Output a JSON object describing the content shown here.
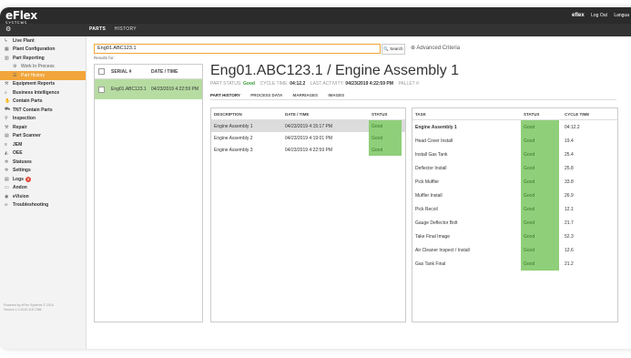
{
  "app": {
    "logo_main": "eFlex",
    "logo_sub": "SYSTEMS",
    "user": "eflex",
    "logout": "Log Out",
    "language": "Langua"
  },
  "top_tabs": {
    "parts": "PARTS",
    "history": "HISTORY"
  },
  "sidebar": {
    "items": [
      {
        "label": "Live Plant",
        "icon": "lightning-icon",
        "type": "item"
      },
      {
        "label": "Plant Configuration",
        "icon": "grid-icon",
        "type": "item"
      },
      {
        "label": "Part Reporting",
        "icon": "bar-chart-icon",
        "type": "item"
      },
      {
        "label": "Work In Process",
        "icon": "gears-icon",
        "type": "sub"
      },
      {
        "label": "Part History",
        "icon": "list-icon",
        "type": "sub-active"
      },
      {
        "label": "Equipment Reports",
        "icon": "wrench-icon",
        "type": "item"
      },
      {
        "label": "Business Intelligence",
        "icon": "search-icon",
        "type": "item"
      },
      {
        "label": "Contain Parts",
        "icon": "hand-icon",
        "type": "item"
      },
      {
        "label": "TNT Contain Parts",
        "icon": "truck-icon",
        "type": "item"
      },
      {
        "label": "Inspection",
        "icon": "magnifier-icon",
        "type": "item"
      },
      {
        "label": "Repair",
        "icon": "hammer-icon",
        "type": "item"
      },
      {
        "label": "Part Scanner",
        "icon": "scanner-icon",
        "type": "item"
      },
      {
        "label": "JEM",
        "icon": "bars-icon",
        "type": "item"
      },
      {
        "label": "OEE",
        "icon": "chart-icon",
        "type": "item"
      },
      {
        "label": "Statuses",
        "icon": "gear-icon",
        "type": "item"
      },
      {
        "label": "Settings",
        "icon": "cog-icon",
        "type": "item"
      },
      {
        "label": "Logs",
        "icon": "document-icon",
        "type": "item",
        "badge": "5"
      },
      {
        "label": "Andon",
        "icon": "monitor-icon",
        "type": "item"
      },
      {
        "label": "eVision",
        "icon": "eye-icon",
        "type": "item"
      },
      {
        "label": "Troubleshooting",
        "icon": "infinity-icon",
        "type": "item"
      }
    ],
    "footer_line1": "Powered by eFlex Systems © 2016",
    "footer_line2": "Version 1.0.2019.116.7386"
  },
  "search": {
    "value": "Eng01.ABC123.1",
    "button": "Search",
    "advanced": "Advanced Criteria",
    "results_label": "Results for:"
  },
  "serial_list": {
    "headers": {
      "serial": "SERIAL #",
      "date": "DATE / TIME"
    },
    "rows": [
      {
        "serial": "Eng01.ABC123.1",
        "date": "04/23/2019 4:22:59 PM"
      }
    ]
  },
  "part": {
    "title": "Eng01.ABC123.1 / Engine Assembly 1",
    "status_label": "PART STATUS:",
    "status_value": "Good",
    "cycle_label": "CYCLE TIME:",
    "cycle_value": "04:12.2",
    "activity_label": "LAST ACTIVITY:",
    "activity_value": "04/23/2019 4:22:59 PM",
    "pallet_label": "PALLET #:",
    "tabs": [
      "PART HISTORY",
      "PROCESS DATA",
      "MARRIAGES",
      "IMAGES"
    ]
  },
  "history_table": {
    "headers": {
      "description": "DESCRIPTION",
      "date": "DATE / TIME",
      "status": "STATUS"
    },
    "rows": [
      {
        "description": "Engine Assembly 1",
        "date": "04/23/2019 4:15:17 PM",
        "status": "Good"
      },
      {
        "description": "Engine Assembly 2",
        "date": "04/23/2019 4:19:01 PM",
        "status": "Good"
      },
      {
        "description": "Engine Assembly 3",
        "date": "04/23/2019 4:22:59 PM",
        "status": "Good"
      }
    ]
  },
  "task_table": {
    "headers": {
      "task": "TASK",
      "status": "STATUS",
      "cycle": "CYCLE TIME"
    },
    "rows": [
      {
        "task": "Engine Assembly 1",
        "status": "Good",
        "cycle": "04:12.2"
      },
      {
        "task": "Head Cover Install",
        "status": "Good",
        "cycle": "19.4"
      },
      {
        "task": "Install Gas Tank",
        "status": "Good",
        "cycle": "25.4"
      },
      {
        "task": "Deflector Install",
        "status": "Good",
        "cycle": "25.8"
      },
      {
        "task": "Pick Muffler",
        "status": "Good",
        "cycle": "33.8"
      },
      {
        "task": "Muffler Install",
        "status": "Good",
        "cycle": "26.9"
      },
      {
        "task": "Pick Recoil",
        "status": "Good",
        "cycle": "12.1"
      },
      {
        "task": "Gauge Deflector Bolt",
        "status": "Good",
        "cycle": "21.7"
      },
      {
        "task": "Take Final Image",
        "status": "Good",
        "cycle": "52.3"
      },
      {
        "task": "Air Cleaner Inspect / Install",
        "status": "Good",
        "cycle": "12.6"
      },
      {
        "task": "Gas Tank Final",
        "status": "Good",
        "cycle": "21.2"
      }
    ]
  },
  "colors": {
    "accent": "#f1a53a",
    "good": "#8fcf7a",
    "topbar": "#2b2b2b"
  }
}
